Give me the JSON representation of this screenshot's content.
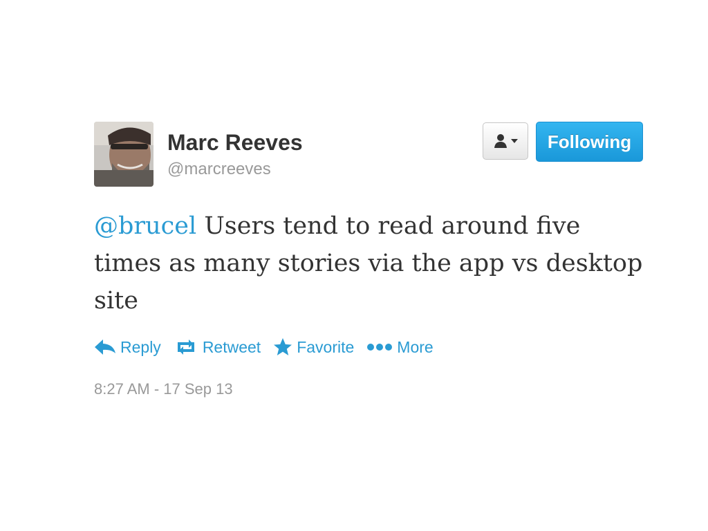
{
  "tweet": {
    "author_name": "Marc Reeves",
    "author_handle": "@marcreeves",
    "mention": "@brucel",
    "body": " Users tend to read around five times as many stories via the app vs desktop site",
    "timestamp": "8:27 AM - 17 Sep 13"
  },
  "buttons": {
    "follow_label": "Following",
    "user_menu_icon": "person-icon",
    "user_menu_caret": "caret-down-icon"
  },
  "actions": [
    {
      "label": "Reply",
      "icon": "reply-icon"
    },
    {
      "label": "Retweet",
      "icon": "retweet-icon"
    },
    {
      "label": "Favorite",
      "icon": "star-icon"
    },
    {
      "label": "More",
      "icon": "more-dots-icon"
    }
  ],
  "colors": {
    "link_blue": "#2a9bd3",
    "follow_button": "#1a98d9",
    "name_text": "#333333",
    "muted_text": "#999999"
  }
}
